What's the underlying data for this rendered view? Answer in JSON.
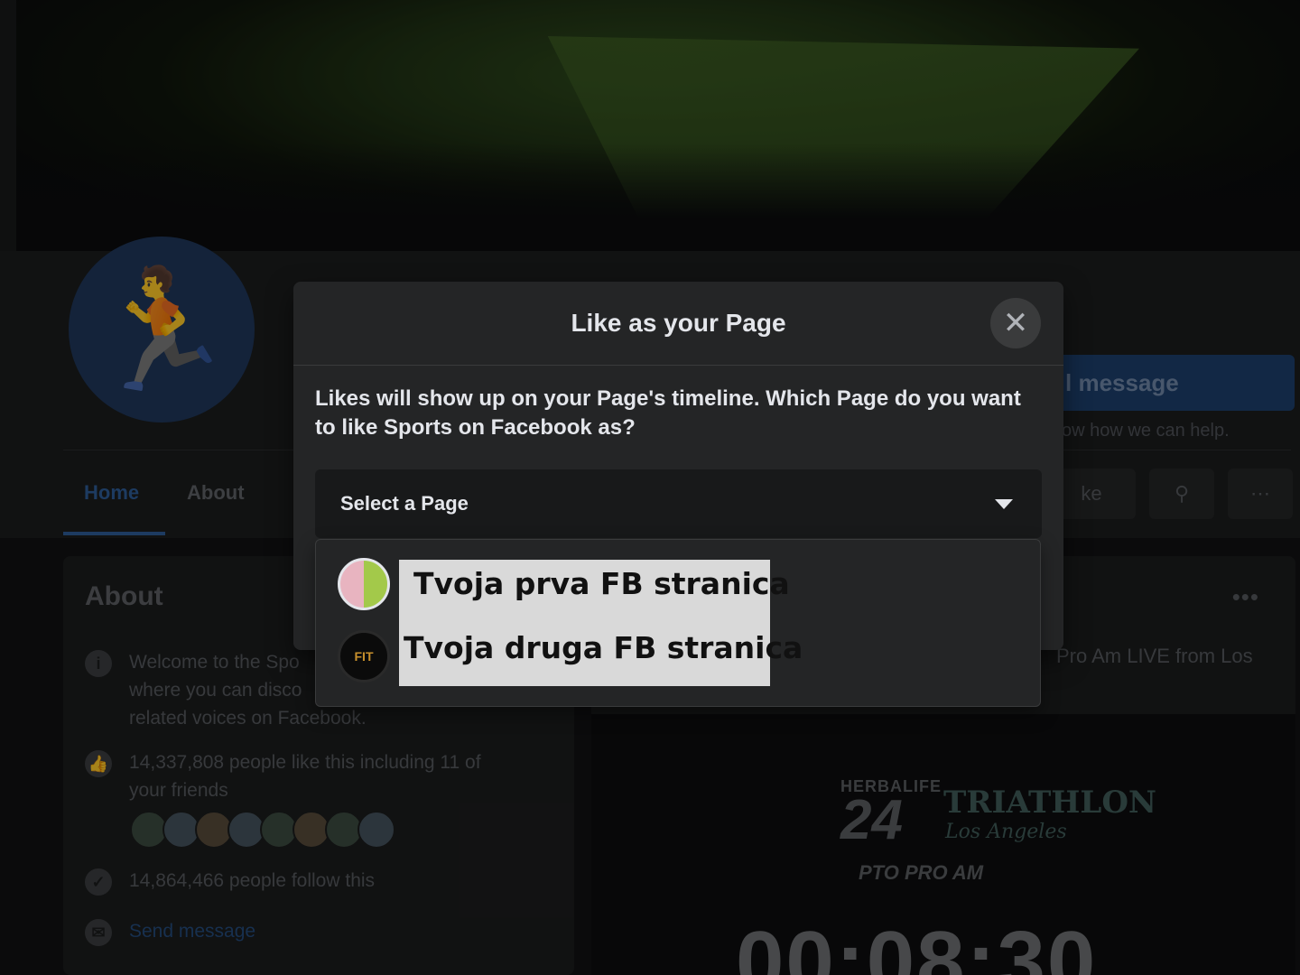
{
  "background_page": {
    "send_message_label": "Send message",
    "send_message_visible": "l message",
    "help_text": "ow how we can help.",
    "tabs": [
      {
        "label": "Home"
      },
      {
        "label": "About"
      }
    ],
    "like_pill": "ke",
    "about": {
      "heading": "About",
      "description": "Welcome to the Spo… where you can disco… related voices on Facebook.",
      "description_lines": [
        "Welcome to the Spo",
        "where you can disco",
        "related voices on Facebook."
      ],
      "likes": "14,337,808 people like this including 11 of your friends",
      "likes_lines": [
        "14,337,808 people like this including 11 of",
        "your friends"
      ],
      "follows": "14,864,466 people follow this",
      "send_message": "Send message"
    },
    "post": {
      "text": "Pro Am LIVE from Los",
      "video": {
        "brand1": "HERBALIFE",
        "brand2": "24",
        "brand3": "TRIATHLON",
        "brand4": "Los Angeles",
        "brand5": "PTO PRO AM",
        "timer": "00:08:30"
      }
    }
  },
  "modal": {
    "title": "Like as your Page",
    "description": "Likes will show up on your Page's timeline. Which Page do you want to like Sports on Facebook as?",
    "select_placeholder": "Select a Page",
    "options": [
      {
        "label": "Tvoja prva FB stranica"
      },
      {
        "label": "Tvoja druga FB stranica"
      }
    ]
  }
}
